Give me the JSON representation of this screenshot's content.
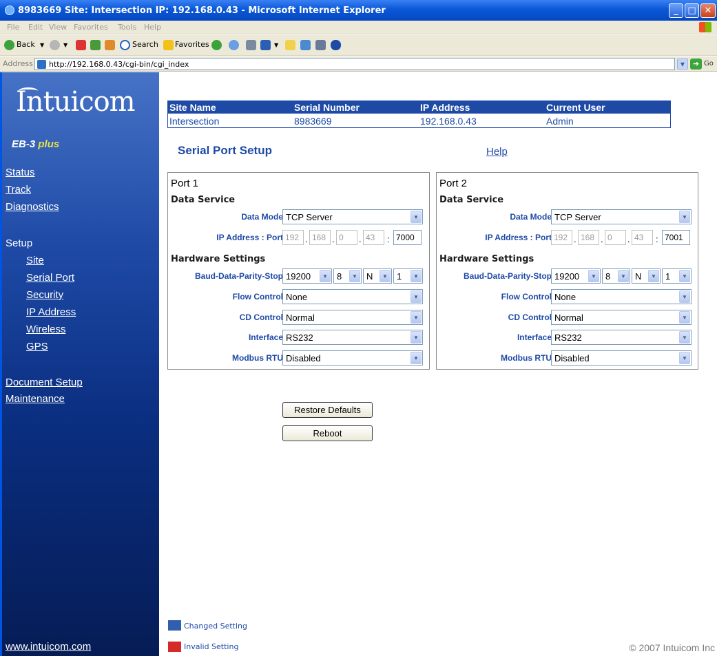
{
  "window": {
    "title": "8983669 Site: Intersection IP: 192.168.0.43 - Microsoft Internet Explorer",
    "minimize": "_",
    "maximize": "□",
    "close": "✕"
  },
  "menu": [
    "File",
    "Edit",
    "View",
    "Favorites",
    "Tools",
    "Help"
  ],
  "toolbar": {
    "back": "Back",
    "search": "Search",
    "favorites": "Favorites"
  },
  "address": {
    "label": "Address",
    "url": "http://192.168.0.43/cgi-bin/cgi_index",
    "go": "Go"
  },
  "sidebar": {
    "logo": "Intuicom",
    "product": "EB-3",
    "product_suffix": "plus",
    "links": {
      "status": "Status",
      "track": "Track",
      "diagnostics": "Diagnostics",
      "setup": "Setup",
      "site": "Site",
      "serial_port": "Serial Port",
      "security": "Security",
      "ip_address": "IP Address",
      "wireless": "Wireless",
      "gps": "GPS",
      "document_setup": "Document Setup",
      "maintenance": "Maintenance"
    },
    "footer_link": "www.intuicom.com"
  },
  "header": {
    "columns": [
      "Site Name",
      "Serial Number",
      "IP Address",
      "Current User"
    ],
    "values": [
      "Intersection",
      "8983669",
      "192.168.0.43",
      "Admin"
    ]
  },
  "page": {
    "title": "Serial Port Setup",
    "help": "Help"
  },
  "labels": {
    "data_service": "Data Service",
    "data_mode": "Data Mode",
    "ip_port": "IP Address : Port",
    "hardware": "Hardware Settings",
    "baud": "Baud-Data-Parity-Stop",
    "flow": "Flow Control",
    "cd": "CD Control",
    "interface": "Interface",
    "modbus": "Modbus RTU"
  },
  "ports": [
    {
      "title": "Port 1",
      "data_mode": "TCP Server",
      "ip": [
        "192",
        "168",
        "0",
        "43"
      ],
      "port": "7000",
      "baud": "19200",
      "data_bits": "8",
      "parity": "N",
      "stop": "1",
      "flow": "None",
      "cd": "Normal",
      "interface": "RS232",
      "modbus": "Disabled"
    },
    {
      "title": "Port 2",
      "data_mode": "TCP Server",
      "ip": [
        "192",
        "168",
        "0",
        "43"
      ],
      "port": "7001",
      "baud": "19200",
      "data_bits": "8",
      "parity": "N",
      "stop": "1",
      "flow": "None",
      "cd": "Normal",
      "interface": "RS232",
      "modbus": "Disabled"
    }
  ],
  "buttons": {
    "restore": "Restore Defaults",
    "reboot": "Reboot"
  },
  "legend": {
    "changed": "Changed Setting",
    "invalid": "Invalid Setting",
    "changed_color": "#2f5fae",
    "invalid_color": "#d42a2a"
  },
  "copyright": "© 2007 Intuicom Inc"
}
